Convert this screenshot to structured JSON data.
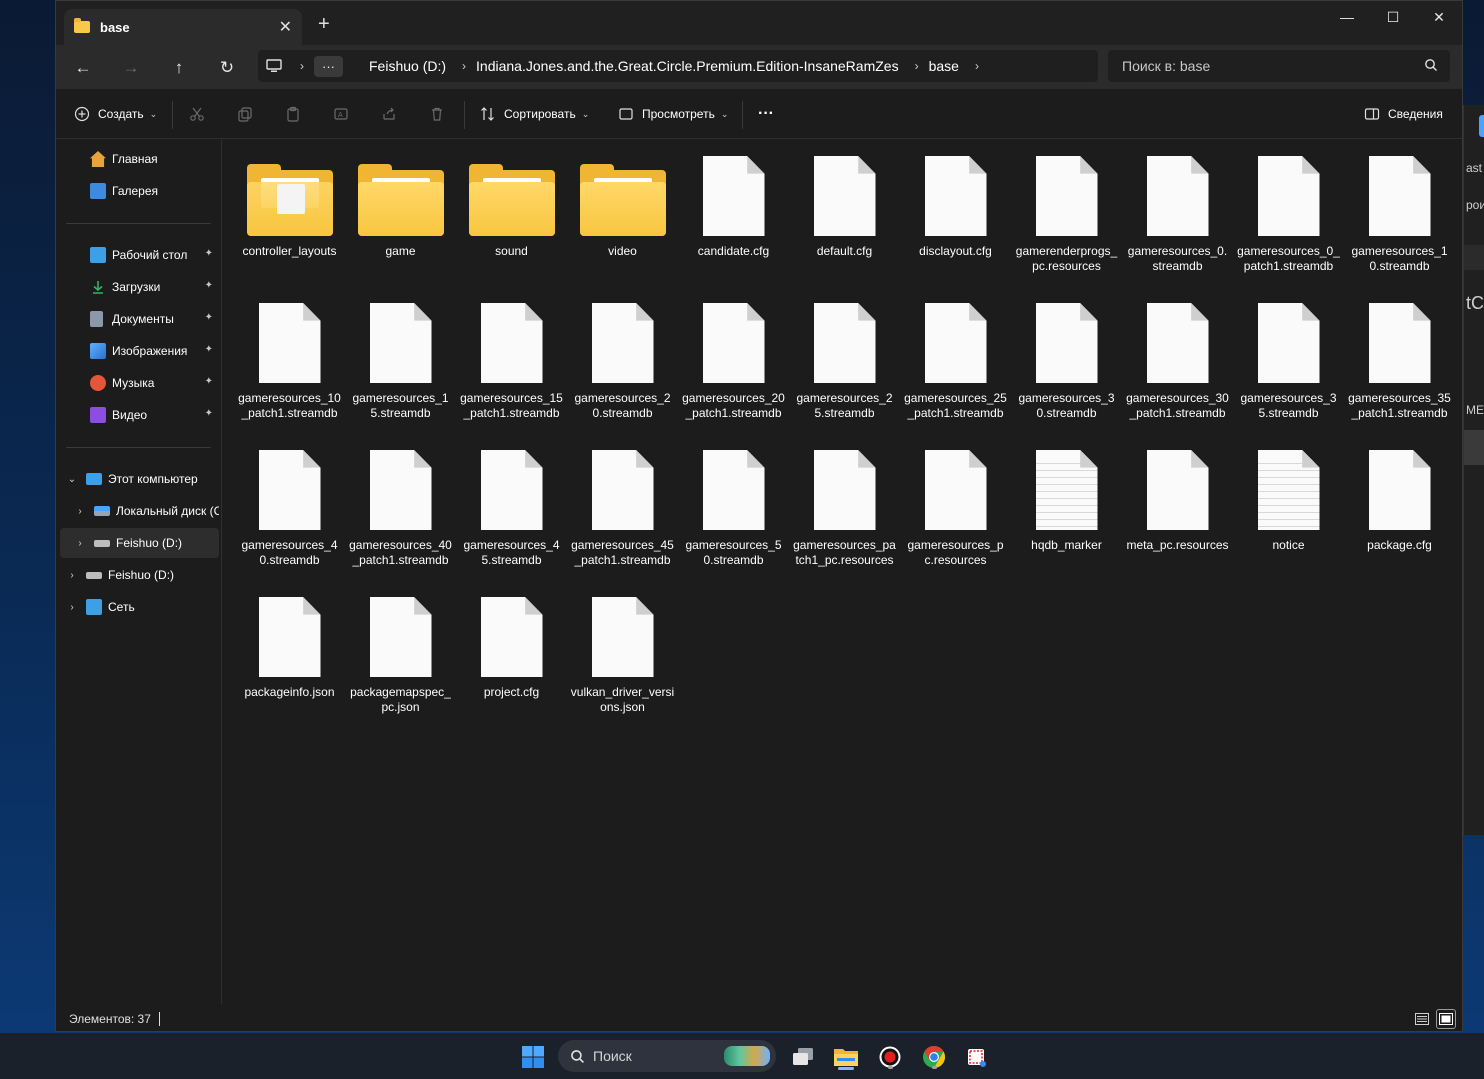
{
  "window": {
    "tab_title": "base",
    "close_tab": "✕",
    "new_tab": "+"
  },
  "window_controls": {
    "minimize": "—",
    "maximize": "☐",
    "close": "✕"
  },
  "nav": {
    "back": "←",
    "forward": "→",
    "up": "↑",
    "refresh": "↻",
    "more": "···",
    "breadcrumbs": [
      "Feishuo (D:)",
      "Indiana.Jones.and.the.Great.Circle.Premium.Edition-InsaneRamZes",
      "base"
    ],
    "sep": "›"
  },
  "search": {
    "placeholder": "Поиск в: base"
  },
  "toolbar": {
    "create": "Создать",
    "sort": "Сортировать",
    "view": "Просмотреть",
    "more": "···",
    "details": "Сведения"
  },
  "sidebar": {
    "quick": [
      {
        "label": "Главная",
        "icon": "home-icon",
        "color": "#e8a33c"
      },
      {
        "label": "Галерея",
        "icon": "gallery-icon",
        "color": "#3d8be0"
      }
    ],
    "pinned": [
      {
        "label": "Рабочий стол",
        "icon": "desktop-icon",
        "color": "#3ba0e6"
      },
      {
        "label": "Загрузки",
        "icon": "download-icon",
        "color": "#2fb36b"
      },
      {
        "label": "Документы",
        "icon": "documents-icon",
        "color": "#8b98a8"
      },
      {
        "label": "Изображения",
        "icon": "pictures-icon",
        "color": "#3d8be0"
      },
      {
        "label": "Музыка",
        "icon": "music-icon",
        "color": "#e6553b"
      },
      {
        "label": "Видео",
        "icon": "video-icon",
        "color": "#8c4de0"
      }
    ],
    "pin_glyph": "📌",
    "tree": [
      {
        "label": "Этот компьютер",
        "icon": "computer-icon",
        "expander": "⌄",
        "color": "#3ba0e6"
      },
      {
        "label": "Локальный диск (C:)",
        "icon": "drive-c-icon",
        "expander": "›",
        "color": "#7aa9d8"
      },
      {
        "label": "Feishuo (D:)",
        "icon": "drive-d-icon",
        "expander": "›",
        "color": "#bdbdbd"
      },
      {
        "label": "Feishuo (D:)",
        "icon": "drive-d-icon",
        "expander": "›",
        "color": "#bdbdbd"
      },
      {
        "label": "Сеть",
        "icon": "network-icon",
        "expander": "›",
        "color": "#3ba0e6"
      }
    ]
  },
  "files": [
    {
      "name": "controller_layouts",
      "kind": "folder-preview"
    },
    {
      "name": "game",
      "kind": "folder"
    },
    {
      "name": "sound",
      "kind": "folder"
    },
    {
      "name": "video",
      "kind": "folder"
    },
    {
      "name": "candidate.cfg",
      "kind": "file"
    },
    {
      "name": "default.cfg",
      "kind": "file"
    },
    {
      "name": "disclayout.cfg",
      "kind": "file"
    },
    {
      "name": "gamerenderprogs_pc.resources",
      "kind": "file"
    },
    {
      "name": "gameresources_0.streamdb",
      "kind": "file"
    },
    {
      "name": "gameresources_0_patch1.streamdb",
      "kind": "file"
    },
    {
      "name": "gameresources_10.streamdb",
      "kind": "file"
    },
    {
      "name": "gameresources_10_patch1.streamdb",
      "kind": "file"
    },
    {
      "name": "gameresources_15.streamdb",
      "kind": "file"
    },
    {
      "name": "gameresources_15_patch1.streamdb",
      "kind": "file"
    },
    {
      "name": "gameresources_20.streamdb",
      "kind": "file"
    },
    {
      "name": "gameresources_20_patch1.streamdb",
      "kind": "file"
    },
    {
      "name": "gameresources_25.streamdb",
      "kind": "file"
    },
    {
      "name": "gameresources_25_patch1.streamdb",
      "kind": "file"
    },
    {
      "name": "gameresources_30.streamdb",
      "kind": "file"
    },
    {
      "name": "gameresources_30_patch1.streamdb",
      "kind": "file"
    },
    {
      "name": "gameresources_35.streamdb",
      "kind": "file"
    },
    {
      "name": "gameresources_35_patch1.streamdb",
      "kind": "file"
    },
    {
      "name": "gameresources_40.streamdb",
      "kind": "file"
    },
    {
      "name": "gameresources_40_patch1.streamdb",
      "kind": "file"
    },
    {
      "name": "gameresources_45.streamdb",
      "kind": "file"
    },
    {
      "name": "gameresources_45_patch1.streamdb",
      "kind": "file"
    },
    {
      "name": "gameresources_50.streamdb",
      "kind": "file"
    },
    {
      "name": "gameresources_patch1_pc.resources",
      "kind": "file"
    },
    {
      "name": "gameresources_pc.resources",
      "kind": "file"
    },
    {
      "name": "hqdb_marker",
      "kind": "text"
    },
    {
      "name": "meta_pc.resources",
      "kind": "file"
    },
    {
      "name": "notice",
      "kind": "text"
    },
    {
      "name": "package.cfg",
      "kind": "file"
    },
    {
      "name": "packageinfo.json",
      "kind": "file"
    },
    {
      "name": "packagemapspec_pc.json",
      "kind": "file"
    },
    {
      "name": "project.cfg",
      "kind": "file"
    },
    {
      "name": "vulkan_driver_versions.json",
      "kind": "file"
    }
  ],
  "status": {
    "count": "Элементов: 37"
  },
  "taskbar": {
    "search_label": "Поиск"
  },
  "background": {
    "frag1": "ast",
    "frag2": "рои",
    "frag3": "tCi",
    "frag4": "ME"
  }
}
